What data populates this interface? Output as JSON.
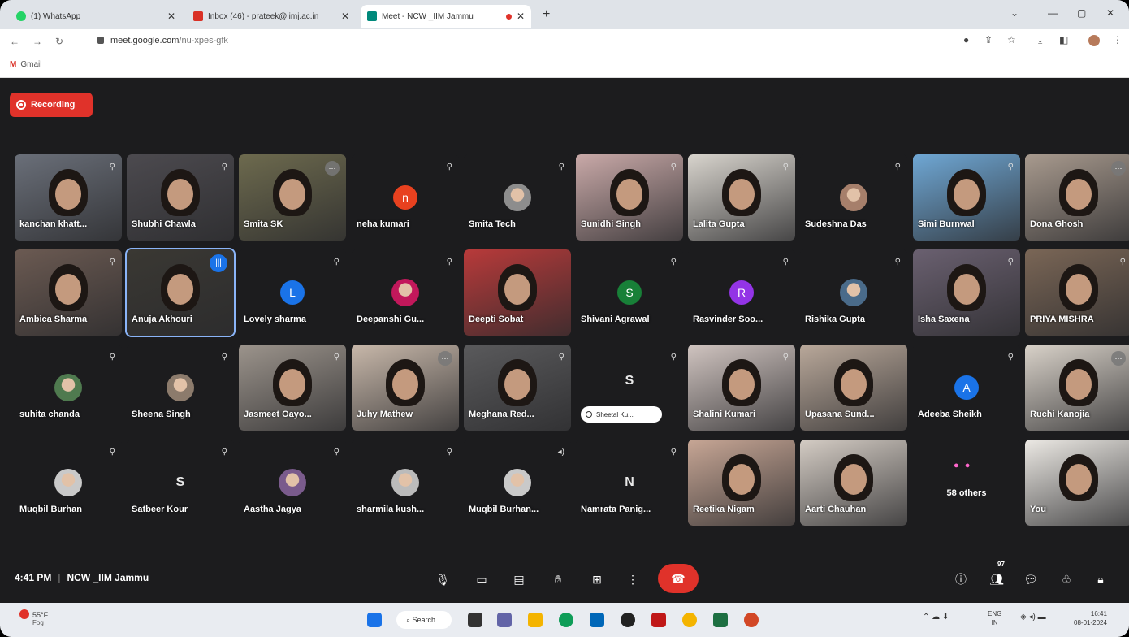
{
  "browser": {
    "tabs": [
      {
        "label": "(1) WhatsApp",
        "color": "#25d366"
      },
      {
        "label": "Inbox (46) - prateek@iimj.ac.in",
        "color": "#d93025"
      },
      {
        "label": "Meet - NCW _IIM Jammu",
        "color": "#00897b"
      }
    ],
    "url_host": "meet.google.com",
    "url_path": "/nu-xpes-gfk",
    "bookmark_gmail": "Gmail"
  },
  "meet": {
    "recording_label": "Recording",
    "time": "4:41 PM",
    "meeting_name": "NCW _IIM Jammu",
    "people_count": "97",
    "others_label": "58 others",
    "chip_label": "Sheetal Ku...",
    "participants": [
      {
        "name": "kanchan khatt...",
        "kind": "video",
        "bg": "#6a6f79",
        "mic": "muted"
      },
      {
        "name": "Shubhi Chawla",
        "kind": "video",
        "bg": "#4c4a4f",
        "mic": "muted"
      },
      {
        "name": "Smita SK",
        "kind": "video",
        "bg": "#6d6a4e",
        "mic": "grey"
      },
      {
        "name": "neha kumari",
        "kind": "letter",
        "letter": "n",
        "bg": "#e8411f",
        "mic": "muted"
      },
      {
        "name": "Smita Tech",
        "kind": "avatar",
        "bg": "#8d8d8d",
        "mic": "muted"
      },
      {
        "name": "Sunidhi Singh",
        "kind": "video",
        "bg": "#c9a9a8",
        "mic": "muted"
      },
      {
        "name": "Lalita Gupta",
        "kind": "video",
        "bg": "#d8d4cd",
        "mic": "muted"
      },
      {
        "name": "Sudeshna Das",
        "kind": "avatar",
        "bg": "#a67f6b",
        "mic": "muted"
      },
      {
        "name": "Simi Burnwal",
        "kind": "video",
        "bg": "#6fa7d4",
        "mic": "muted"
      },
      {
        "name": "Dona Ghosh",
        "kind": "video",
        "bg": "#a89a8e",
        "mic": "grey"
      },
      {
        "name": "Ambica Sharma",
        "kind": "video",
        "bg": "#6b5a52",
        "mic": "muted"
      },
      {
        "name": "Anuja Akhouri",
        "kind": "video",
        "bg": "#3a3833",
        "mic": "blue",
        "selected": true
      },
      {
        "name": "Lovely sharma",
        "kind": "letter",
        "letter": "L",
        "bg": "#1a73e8",
        "mic": "muted"
      },
      {
        "name": "Deepanshi Gu...",
        "kind": "avatar",
        "bg": "#c2185b",
        "mic": "muted"
      },
      {
        "name": "Deepti Sobat",
        "kind": "video",
        "bg": "#b83a3a",
        "mic": "none"
      },
      {
        "name": "Shivani Agrawal",
        "kind": "letter",
        "letter": "S",
        "bg": "#188038",
        "mic": "muted"
      },
      {
        "name": "Rasvinder Soo...",
        "kind": "letter",
        "letter": "R",
        "bg": "#9334e6",
        "mic": "muted"
      },
      {
        "name": "Rishika Gupta",
        "kind": "avatar",
        "bg": "#4a6b8a",
        "mic": "muted"
      },
      {
        "name": "Isha Saxena",
        "kind": "video",
        "bg": "#6a6070",
        "mic": "muted"
      },
      {
        "name": "PRIYA MISHRA",
        "kind": "video",
        "bg": "#7a6656",
        "mic": "muted"
      },
      {
        "name": "suhita chanda",
        "kind": "avatar",
        "bg": "#4f7a4f",
        "mic": "muted"
      },
      {
        "name": "Sheena Singh",
        "kind": "avatar",
        "bg": "#8c7b6c",
        "mic": "muted"
      },
      {
        "name": "Jasmeet Oayo...",
        "kind": "video",
        "bg": "#9c948c",
        "mic": "muted"
      },
      {
        "name": "Juhy Mathew",
        "kind": "video",
        "bg": "#c8b8aa",
        "mic": "grey"
      },
      {
        "name": "Meghana Red...",
        "kind": "video",
        "bg": "#5a5a5c",
        "mic": "muted"
      },
      {
        "name": "",
        "kind": "chip",
        "letter": "S",
        "bg": "#188038",
        "mic": "muted"
      },
      {
        "name": "Shalini Kumari",
        "kind": "video",
        "bg": "#d0c4c0",
        "mic": "muted"
      },
      {
        "name": "Upasana Sund...",
        "kind": "video",
        "bg": "#b9a89a",
        "mic": "none"
      },
      {
        "name": "Adeeba Sheikh",
        "kind": "letter",
        "letter": "A",
        "bg": "#1a73e8",
        "mic": "muted"
      },
      {
        "name": "Ruchi Kanojia",
        "kind": "video",
        "bg": "#d9d2c9",
        "mic": "grey"
      },
      {
        "name": "Muqbil Burhan",
        "kind": "avatar",
        "bg": "#c9c9c9",
        "mic": "muted"
      },
      {
        "name": "Satbeer Kour",
        "kind": "letter",
        "letter": "S",
        "bg": "transparent",
        "mic": "muted",
        "plain": true
      },
      {
        "name": "Aastha Jagya",
        "kind": "avatar",
        "bg": "#7a5b8c",
        "mic": "muted"
      },
      {
        "name": "sharmila kush...",
        "kind": "avatar",
        "bg": "#bbbbbb",
        "mic": "muted"
      },
      {
        "name": "Muqbil Burhan...",
        "kind": "avatar",
        "bg": "#c9c9c9",
        "mic": "speaker"
      },
      {
        "name": "Namrata Panig...",
        "kind": "letter",
        "letter": "N",
        "bg": "transparent",
        "mic": "muted",
        "plain": true
      },
      {
        "name": "Reetika Nigam",
        "kind": "video",
        "bg": "#c7a695",
        "mic": "none"
      },
      {
        "name": "Aarti Chauhan",
        "kind": "video",
        "bg": "#d4ccc4",
        "mic": "none"
      },
      {
        "name": "",
        "kind": "others",
        "bg": "#1c1c1e",
        "mic": "none"
      },
      {
        "name": "You",
        "kind": "video",
        "bg": "#ece9e4",
        "mic": "none"
      }
    ]
  },
  "taskbar": {
    "weather_temp": "55°F",
    "weather_desc": "Fog",
    "search_label": "Search",
    "lang_line1": "ENG",
    "lang_line2": "IN",
    "clock_time": "16:41",
    "clock_date": "08-01-2024"
  }
}
